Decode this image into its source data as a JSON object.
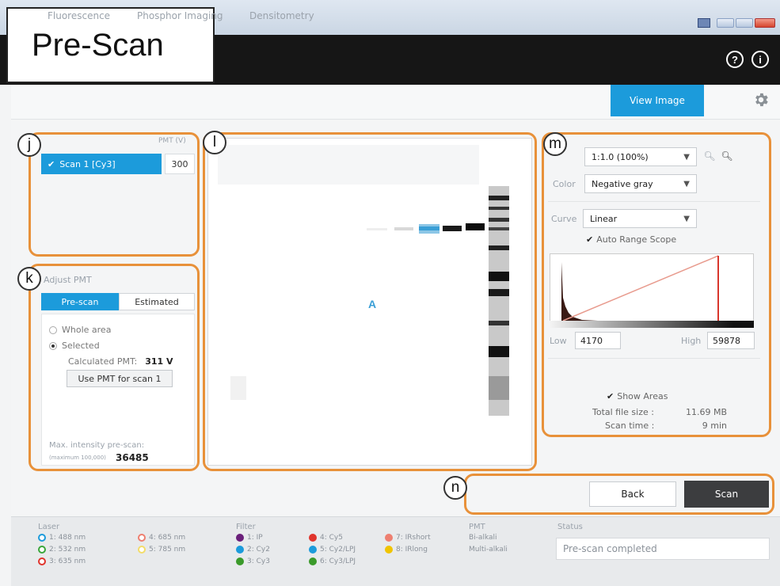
{
  "title_label": "Pre-Scan",
  "tabs": [
    {
      "label": "Fluorescence"
    },
    {
      "label": "Phosphor Imaging"
    },
    {
      "label": "Densitometry"
    }
  ],
  "view_image_label": "View Image",
  "callouts": {
    "j": "j",
    "k": "k",
    "l": "l",
    "m": "m",
    "n": "n"
  },
  "scan_list": {
    "pmt_header": "PMT (V)",
    "item": "Scan 1 [Cy3]",
    "pmt_value": "300"
  },
  "adjust_pmt": {
    "label": "Adjust PMT",
    "tab_prescan": "Pre-scan",
    "tab_estimated": "Estimated",
    "whole_area": "Whole area",
    "selected": "Selected",
    "calc_label": "Calculated PMT:",
    "calc_value": "311 V",
    "use_button": "Use PMT for scan 1",
    "max_label": "Max. intensity pre-scan:",
    "max_sub": "(maximum 100,000)",
    "max_value": "36485"
  },
  "preview": {
    "marker": "A"
  },
  "image_settings": {
    "zoom": "1:1.0 (100%)",
    "color_label": "Color",
    "color_value": "Negative gray",
    "curve_label": "Curve",
    "curve_value": "Linear",
    "auto_range": "Auto Range Scope",
    "low_label": "Low",
    "low_value": "4170",
    "high_label": "High",
    "high_value": "59878",
    "show_areas": "Show Areas",
    "file_size_label": "Total file size :",
    "file_size_value": "11.69 MB",
    "scan_time_label": "Scan time :",
    "scan_time_value": "9 min"
  },
  "buttons": {
    "back": "Back",
    "scan": "Scan"
  },
  "footer": {
    "laser_head": "Laser",
    "lasers": [
      {
        "label": "1: 488 nm",
        "color": "#1c9bdb"
      },
      {
        "label": "2: 532 nm",
        "color": "#3aa63a"
      },
      {
        "label": "3: 635 nm",
        "color": "#e0342c"
      },
      {
        "label": "4: 685 nm",
        "color": "#ee7f70"
      },
      {
        "label": "5: 785 nm",
        "color": "#f3dd6a"
      }
    ],
    "filter_head": "Filter",
    "filters": [
      {
        "label": "1: IP",
        "color": "#6a1f7a"
      },
      {
        "label": "2: Cy2",
        "color": "#1c9bdb"
      },
      {
        "label": "3: Cy3",
        "color": "#3a9a2a"
      },
      {
        "label": "4: Cy5",
        "color": "#e0342c"
      },
      {
        "label": "5: Cy2/LPJ",
        "color": "#1c9bdb"
      },
      {
        "label": "6: Cy3/LPJ",
        "color": "#3a9a2a"
      },
      {
        "label": "7: IRshort",
        "color": "#ee7f70"
      },
      {
        "label": "8: IRlong",
        "color": "#f0c400"
      }
    ],
    "pmt_head": "PMT",
    "pmt_lines": [
      "Bi-alkali",
      "Multi-alkali"
    ],
    "status_head": "Status",
    "status_value": "Pre-scan completed"
  }
}
